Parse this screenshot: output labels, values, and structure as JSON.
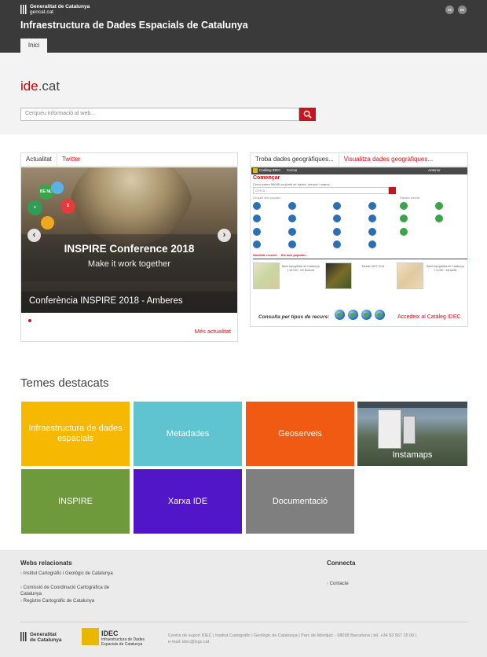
{
  "header": {
    "gencat_line1": "Generalitat de Catalunya",
    "gencat_line2": "gencat.cat",
    "lang_es": "es",
    "lang_en": "en",
    "site_title": "Infraestructura de Dades Espacials de Catalunya",
    "nav_tab": "Inici"
  },
  "hero": {
    "logo_part1": "ide",
    "logo_part2": ".cat",
    "search_placeholder": "Cerqueu informació al web..."
  },
  "news": {
    "tab_active": "Actualitat",
    "tab_inactive": "Twitter",
    "slide_conference": "INSPIRE Conference 2018",
    "slide_subtitle": "Make it work together",
    "slide_caption": "Conferència INSPIRE 2018 - Amberes",
    "badges": [
      "BE NL",
      "S",
      "ε"
    ],
    "more_link": "Més actualitat"
  },
  "geo": {
    "tab_active": "Troba dades geogràfiques...",
    "tab_inactive": "Visualitza dades geogràfiques...",
    "bar_logo": "Catàleg IDEC",
    "bar_search": "Cercar",
    "bar_back": "Anterior",
    "comencar": "Començar",
    "comencar_sub": "Cerca sobre 56085 conjunts de dades, serveis i mapes...",
    "search_placeholder": "Cerca...",
    "popular_label": "Cerques més populars",
    "recent_label": "Ràpides recents",
    "tab_bar_left": "Novetats recents",
    "tab_bar_right": "Els més populars",
    "thumbs": [
      "Base topogràfica de Catalunya 1:25 000 - full Bossost",
      "Mosaic MDT 2016",
      "Base topogràfica de Catalunya 1:5 000 - full Alella"
    ],
    "consulta": "Consulta per tipus de recurs:",
    "accedeix": "Accedeix al Catàleg IDEC"
  },
  "temes": {
    "title": "Temes destacats",
    "tiles": [
      {
        "label": "Infraestructura de dades espacials",
        "color": "#f6b800"
      },
      {
        "label": "Metadades",
        "color": "#5fc3d0"
      },
      {
        "label": "Geoserveis",
        "color": "#f05a12"
      },
      {
        "label": "Instamaps",
        "color": "#556655"
      },
      {
        "label": "INSPIRE",
        "color": "#6e9a3c"
      },
      {
        "label": "Xarxa IDE",
        "color": "#5016c8"
      },
      {
        "label": "Documentació",
        "color": "#7f7f7f"
      }
    ]
  },
  "footer": {
    "webs_title": "Webs relacionats",
    "webs": [
      "Institut Cartogràfic i Geològic de Catalunya",
      "Comissió de Coordinació Cartogràfica de Catalunya",
      "Registre Cartogràfic de Catalunya"
    ],
    "connecta_title": "Connecta",
    "connecta_link": "Contacte",
    "logo1_line1": "Generalitat",
    "logo1_line2": "de Catalunya",
    "logo2_title": "IDEC",
    "logo2_sub": "Infraestructura de Dades Espacials de Catalunya",
    "info_line1": "Centre de suport IDEC | Institut Cartogràfic i Geològic de Catalunya | Parc de Montjuïc - 08038 Barcelona | tel. +34 93 567 15 00 |",
    "info_line2": "e-mail: idec@icgc.cat"
  }
}
